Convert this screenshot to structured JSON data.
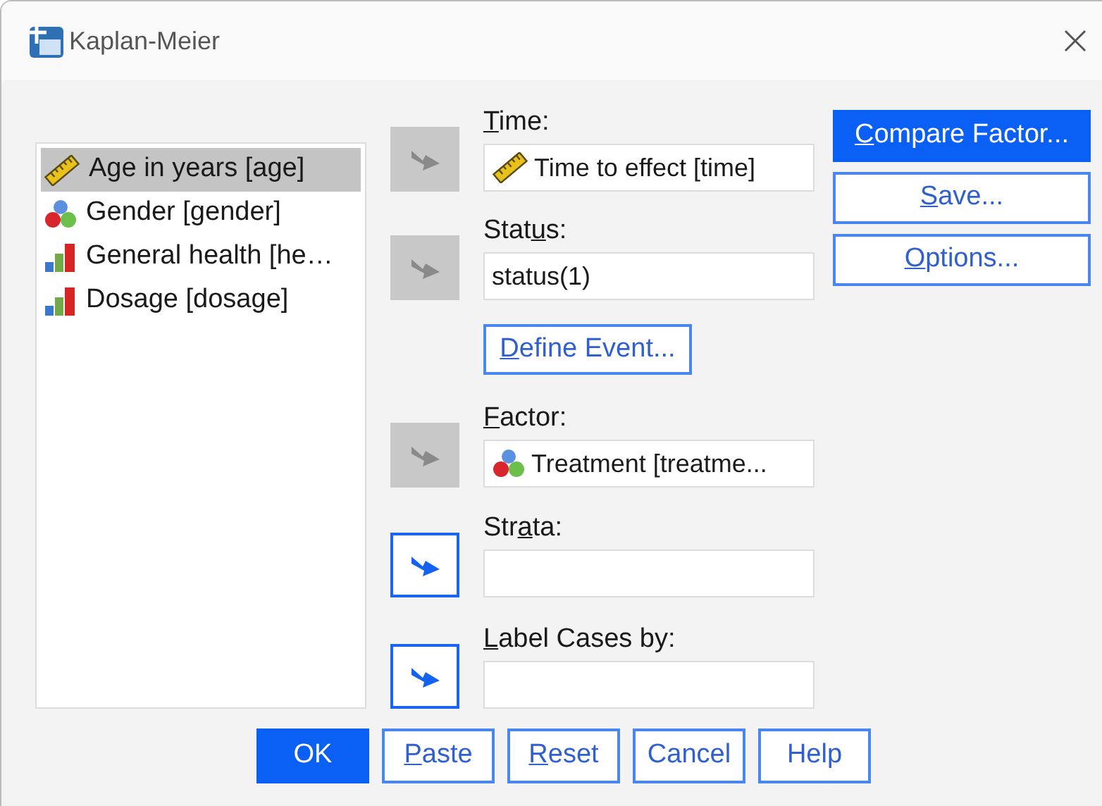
{
  "window": {
    "title": "Kaplan-Meier"
  },
  "variables": [
    {
      "label": "Age in years [age]",
      "kind": "scale",
      "selected": true
    },
    {
      "label": "Gender [gender]",
      "kind": "nominal",
      "selected": false
    },
    {
      "label": "General health [he…",
      "kind": "ordinal",
      "selected": false
    },
    {
      "label": "Dosage [dosage]",
      "kind": "ordinal",
      "selected": false
    }
  ],
  "targets": [
    {
      "label": {
        "key": "T",
        "after": "ime:"
      },
      "arrow_enabled": false,
      "value": {
        "text": "Time to effect [time]",
        "kind": "scale"
      }
    },
    {
      "label": {
        "before": "Stat",
        "key": "u",
        "after": "s:"
      },
      "arrow_enabled": false,
      "value": {
        "text": "status(1)"
      },
      "button": {
        "key": "D",
        "after": "efine Event..."
      }
    },
    {
      "label": {
        "key": "F",
        "after": "actor:"
      },
      "arrow_enabled": false,
      "value": {
        "text": "Treatment [treatme...",
        "kind": "nominal"
      }
    },
    {
      "label": {
        "before": "Str",
        "key": "a",
        "after": "ta:"
      },
      "arrow_enabled": true
    },
    {
      "label": {
        "key": "L",
        "after": "abel Cases by:"
      },
      "arrow_enabled": true
    }
  ],
  "side_buttons": [
    {
      "label": {
        "key": "C",
        "after": "ompare Factor..."
      },
      "selected": true
    },
    {
      "label": {
        "key": "S",
        "after": "ave..."
      },
      "selected": false
    },
    {
      "label": {
        "key": "O",
        "after": "ptions..."
      },
      "selected": false
    }
  ],
  "bottom_buttons": [
    {
      "label": {
        "before": "OK"
      },
      "selected": true
    },
    {
      "label": {
        "key": "P",
        "after": "aste"
      },
      "selected": false
    },
    {
      "label": {
        "key": "R",
        "after": "eset"
      },
      "selected": false
    },
    {
      "label": {
        "before": "Cancel"
      },
      "selected": false
    },
    {
      "label": {
        "before": "Help"
      },
      "selected": false
    }
  ]
}
